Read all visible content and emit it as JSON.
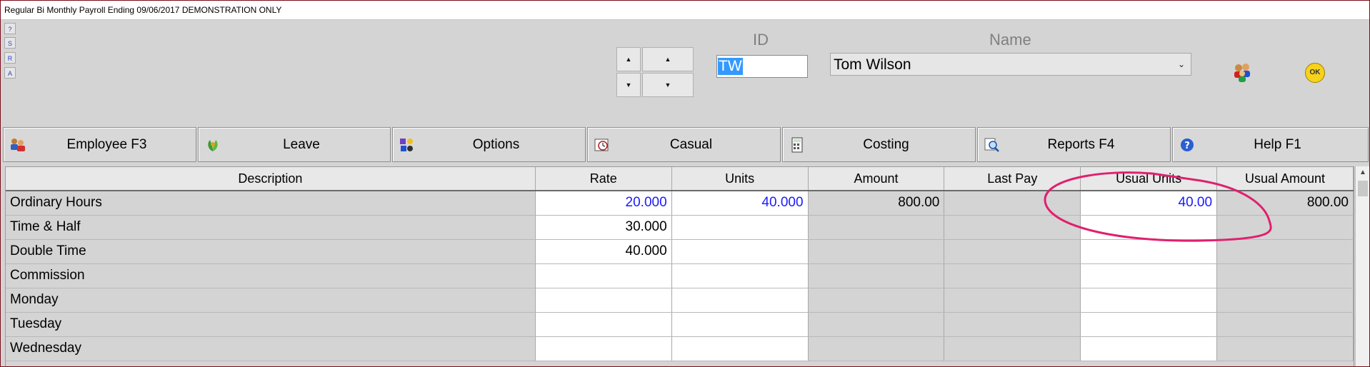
{
  "window": {
    "title": "Regular Bi Monthly Payroll Ending 09/06/2017 DEMONSTRATION ONLY"
  },
  "side_buttons": [
    "?",
    "S",
    "R",
    "A"
  ],
  "nav": {
    "up_symbol": "▲",
    "down_symbol": "▼"
  },
  "header": {
    "id_label": "ID",
    "id_value": "TW",
    "name_label": "Name",
    "name_value": "Tom Wilson",
    "ok_label": "OK"
  },
  "toolbar": [
    {
      "label": "Employee F3",
      "icon": "people-icon"
    },
    {
      "label": "Leave",
      "icon": "leaf-icon"
    },
    {
      "label": "Options",
      "icon": "options-icon"
    },
    {
      "label": "Casual",
      "icon": "clock-icon"
    },
    {
      "label": "Costing",
      "icon": "calculator-icon"
    },
    {
      "label": "Reports F4",
      "icon": "magnifier-icon"
    },
    {
      "label": "Help F1",
      "icon": "help-icon"
    }
  ],
  "grid": {
    "columns": [
      "Description",
      "Rate",
      "Units",
      "Amount",
      "Last Pay",
      "Usual Units",
      "Usual Amount"
    ],
    "rows": [
      {
        "desc": "Ordinary Hours",
        "rate": "20.000",
        "units": "40.000",
        "amount": "800.00",
        "last_pay": "",
        "usual_units": "40.00",
        "usual_amount": "800.00"
      },
      {
        "desc": "Time & Half",
        "rate": "30.000",
        "units": "",
        "amount": "",
        "last_pay": "",
        "usual_units": "",
        "usual_amount": ""
      },
      {
        "desc": "Double Time",
        "rate": "40.000",
        "units": "",
        "amount": "",
        "last_pay": "",
        "usual_units": "",
        "usual_amount": ""
      },
      {
        "desc": "Commission",
        "rate": "",
        "units": "",
        "amount": "",
        "last_pay": "",
        "usual_units": "",
        "usual_amount": ""
      },
      {
        "desc": "Monday",
        "rate": "",
        "units": "",
        "amount": "",
        "last_pay": "",
        "usual_units": "",
        "usual_amount": ""
      },
      {
        "desc": "Tuesday",
        "rate": "",
        "units": "",
        "amount": "",
        "last_pay": "",
        "usual_units": "",
        "usual_amount": ""
      },
      {
        "desc": "Wednesday",
        "rate": "",
        "units": "",
        "amount": "",
        "last_pay": "",
        "usual_units": "",
        "usual_amount": ""
      }
    ]
  },
  "colors": {
    "accent_blue": "#1a1aff",
    "highlight_ellipse": "#e0206e",
    "selection": "#3399ff"
  }
}
